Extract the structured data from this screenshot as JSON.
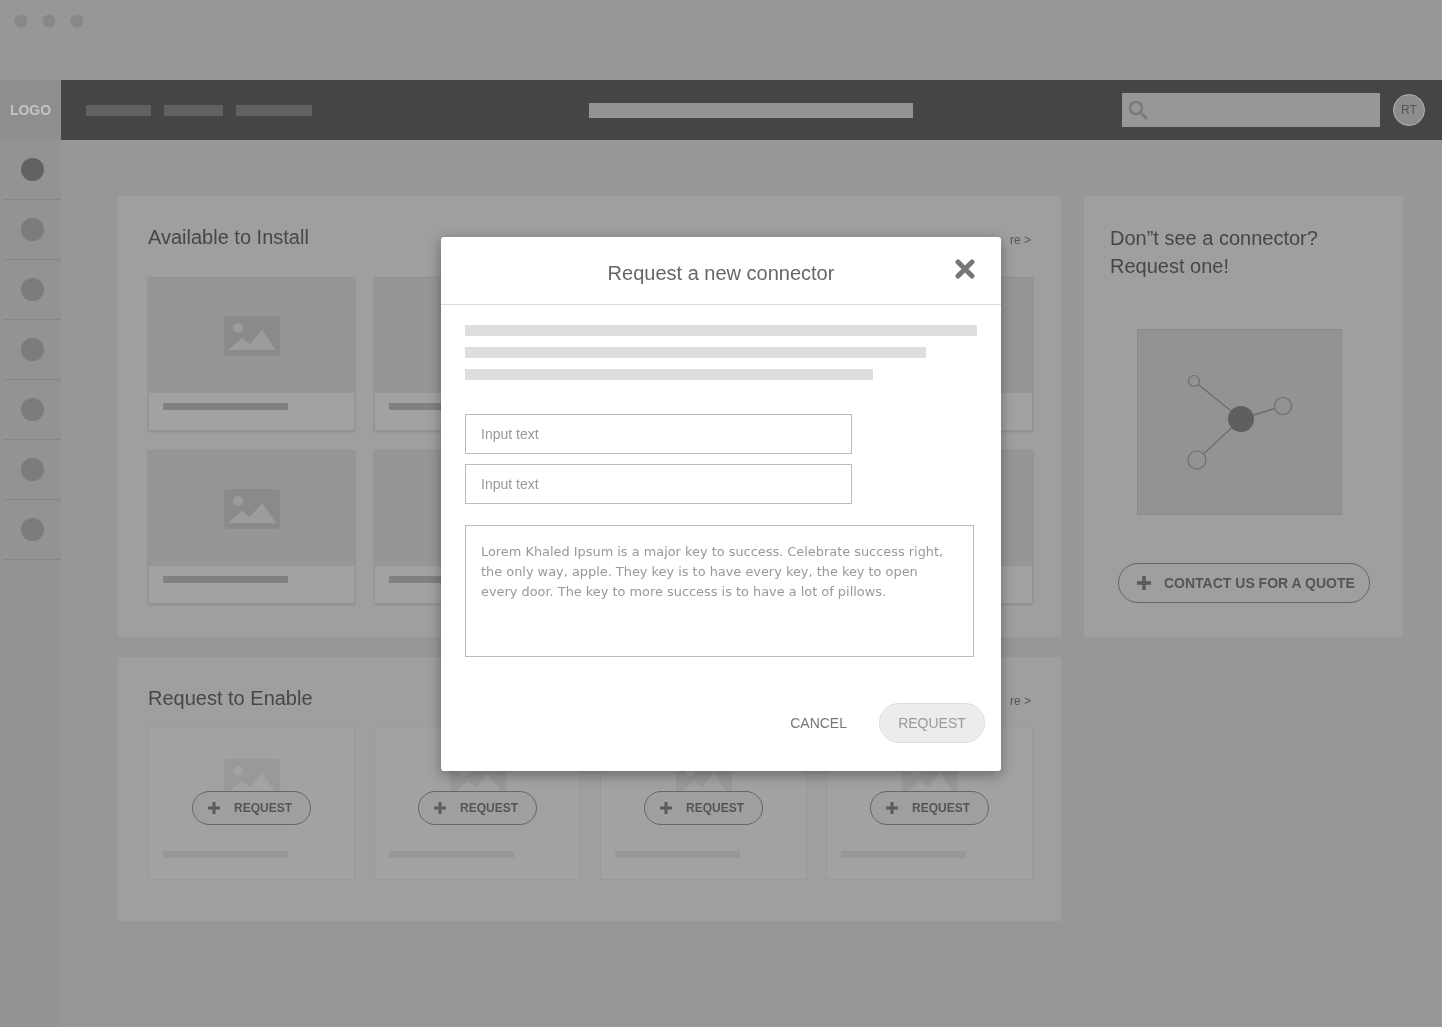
{
  "header": {
    "logo": "LOGO",
    "avatar": "RT"
  },
  "sidebar": {
    "items": [
      {
        "selected": true
      },
      {
        "selected": false
      },
      {
        "selected": false
      },
      {
        "selected": false
      },
      {
        "selected": false
      },
      {
        "selected": false
      },
      {
        "selected": false
      }
    ]
  },
  "available": {
    "title": "Available to Install",
    "link": "re >"
  },
  "request_to_enable": {
    "title": "Request to Enable",
    "link": "re >",
    "cards": [
      {
        "button": "REQUEST"
      },
      {
        "button": "REQUEST"
      },
      {
        "button": "REQUEST"
      },
      {
        "button": "REQUEST"
      }
    ]
  },
  "side_panel": {
    "title": "Don”t see a connector?\nRequest one!",
    "button": "CONTACT US FOR A QUOTE"
  },
  "modal": {
    "title": "Request a new connector",
    "fields": [
      {
        "placeholder": "Input text"
      },
      {
        "placeholder": "Input text"
      }
    ],
    "message": "Lorem Khaled Ipsum is a major key to success. Celebrate success right, the only way, apple. They key is to have every key, the key to open every door. The key to more success is to have a lot of pillows.",
    "buttons": [
      {
        "label": "CANCEL",
        "kind": "text"
      },
      {
        "label": "REQUEST",
        "kind": "pill",
        "disabled": true
      }
    ]
  }
}
